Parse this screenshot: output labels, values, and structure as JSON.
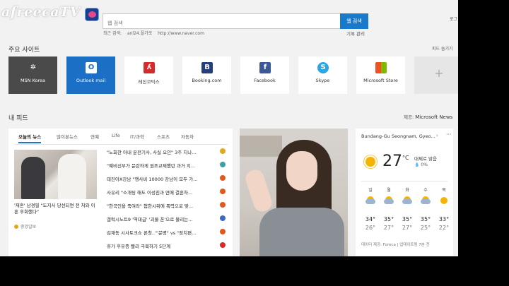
{
  "overlay": {
    "logo": "afreecaTV"
  },
  "search": {
    "placeholder": "웹 검색",
    "button_label": "웹 검색",
    "recent_label": "최근 검색:",
    "recent_items": [
      "anl24.플가로",
      "http://www.naver.com"
    ],
    "history_label": "기록 관리"
  },
  "corner_label": "로그",
  "top_sites": {
    "title": "주요 사이트",
    "hide_label": "피드 숨기기",
    "tiles": [
      {
        "label": "MSN Korea",
        "icon": "msn-icon",
        "color": "#555555"
      },
      {
        "label": "Outlook mail",
        "icon": "outlook-icon",
        "color": "#1b6fc4"
      },
      {
        "label": "레진코믹스",
        "icon": "lezhin-icon",
        "color": "#d62b2b"
      },
      {
        "label": "Booking.com",
        "icon": "booking-icon",
        "color": "#243f7c"
      },
      {
        "label": "Facebook",
        "icon": "facebook-icon",
        "color": "#3b5998"
      },
      {
        "label": "Skype",
        "icon": "skype-icon",
        "color": "#2aa5e6"
      },
      {
        "label": "Microsoft Store",
        "icon": "store-icon",
        "color": "#2b2b2b"
      }
    ]
  },
  "feed": {
    "title": "내 피드",
    "source_prefix": "제공:",
    "source_name": "Microsoft News",
    "tabs": [
      "오늘의 뉴스",
      "많이본뉴스",
      "연예",
      "Life",
      "IT/과학",
      "스포츠",
      "자동차"
    ],
    "featured_title": "'재혼' 남경필 \"도지사 당선되면 전 처와 이혼 후회했다\"",
    "featured_source": "중앙일보",
    "headlines": [
      {
        "text": "\"노회찬 아내 운전기사, 사실 오인\" 3주 지나...",
        "color": "#e0a81a"
      },
      {
        "text": "\"예비신부가 문란하게 원조교제했던 과거 지...",
        "color": "#3aa0a6"
      },
      {
        "text": "태진아X강남 \"행사비 10000 강남이 모두 가...",
        "color": "#e05a1a"
      },
      {
        "text": "사유리 \"소개팅 해도 이성친과 연애 결혼하...",
        "color": "#e05a1a"
      },
      {
        "text": "\"한국인을 죽여라\" 혐한시위에 폭력으로 맞...",
        "color": "#e05a1a"
      },
      {
        "text": "갤럭시노트9 '역대급' '괴물 폰'으로 불리는...",
        "color": "#3a6ac6"
      },
      {
        "text": "김재동 시사토크쇼 론칭..'\"문명\" vs \"정치편...",
        "color": "#e05a1a"
      },
      {
        "text": "휴가 후유증 빨리 극복하기 5단계",
        "color": "#d62b2b"
      }
    ]
  },
  "weather": {
    "location": "Bundang-Gu Seongnam, Gyeo...",
    "temp": "27",
    "unit": "°C",
    "condition": "대체로 맑음",
    "precip": "0%",
    "days": [
      {
        "d": "일",
        "hi": "34°",
        "lo": "26°",
        "icon": "partly-cloudy-icon"
      },
      {
        "d": "월",
        "hi": "35°",
        "lo": "27°",
        "icon": "partly-cloudy-icon"
      },
      {
        "d": "화",
        "hi": "35°",
        "lo": "27°",
        "icon": "partly-cloudy-icon"
      },
      {
        "d": "수",
        "hi": "35°",
        "lo": "25°",
        "icon": "partly-cloudy-icon"
      },
      {
        "d": "목",
        "hi": "33°",
        "lo": "22°",
        "icon": "sunny-icon"
      }
    ],
    "source": "데이터 제공: Foreca | 업데이트됨 7분 전"
  }
}
